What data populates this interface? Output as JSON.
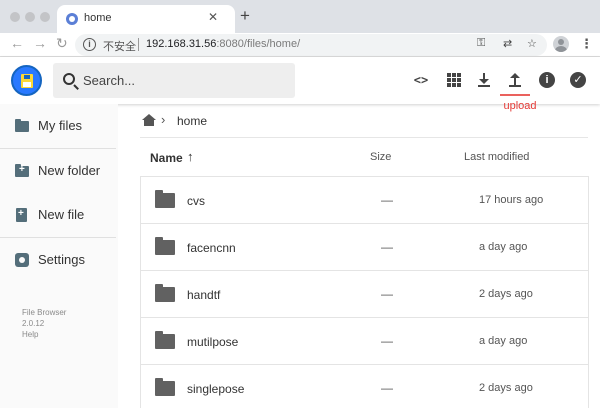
{
  "browser": {
    "tab_title": "home",
    "tab_close": "✕",
    "new_tab": "+",
    "security_label": "不安全",
    "url_host": "192.168.31.56",
    "url_path": ":8080/files/home/",
    "nav_back": "←",
    "nav_forward": "→",
    "nav_reload": "↻",
    "info_glyph": "i",
    "key_icon_glyph": "⚿",
    "translate_icon_glyph": "⇄",
    "star_icon_glyph": "☆",
    "menu_glyph": "⋮"
  },
  "header": {
    "search_placeholder": "Search...",
    "code_glyph": "<>",
    "info_glyph": "i",
    "check_glyph": "✓",
    "annotation": "upload"
  },
  "sidebar": {
    "items": [
      {
        "label": "My files",
        "icon": "folder-icon"
      },
      {
        "label": "New folder",
        "icon": "create-folder-icon"
      },
      {
        "label": "New file",
        "icon": "note-add-icon"
      },
      {
        "label": "Settings",
        "icon": "settings-icon"
      }
    ],
    "credits": {
      "app_name": "File Browser",
      "version": "2.0.12",
      "help": "Help"
    }
  },
  "breadcrumb": {
    "separator": "›",
    "current": "home"
  },
  "list": {
    "columns": {
      "name": "Name",
      "sort_glyph": "↑",
      "size": "Size",
      "modified": "Last modified"
    },
    "rows": [
      {
        "name": "cvs",
        "size": "—",
        "modified": "17 hours ago"
      },
      {
        "name": "facencnn",
        "size": "—",
        "modified": "a day ago"
      },
      {
        "name": "handtf",
        "size": "—",
        "modified": "2 days ago"
      },
      {
        "name": "mutilpose",
        "size": "—",
        "modified": "a day ago"
      },
      {
        "name": "singlepose",
        "size": "—",
        "modified": "2 days ago"
      }
    ]
  },
  "colors": {
    "accent": "#2979ff",
    "annotation": "#e53935",
    "sidebar_icon": "#546e7a",
    "folder_icon": "#616161"
  }
}
